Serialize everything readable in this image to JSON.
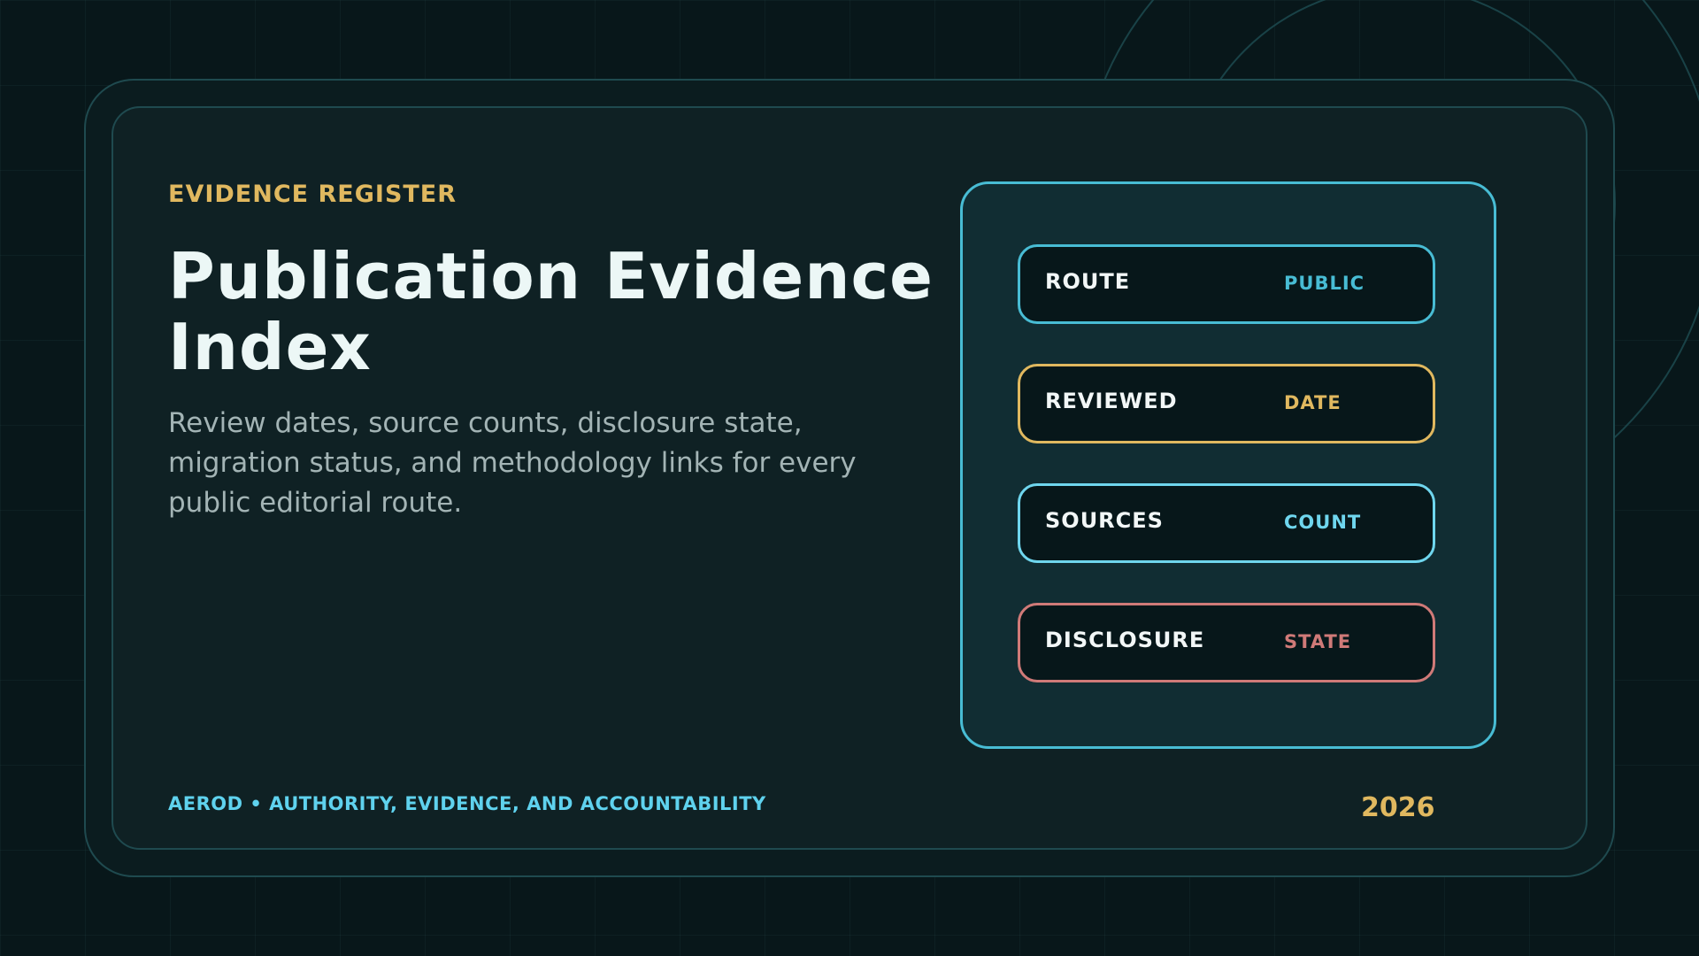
{
  "header": {
    "eyebrow": "EVIDENCE REGISTER",
    "title": "Publication Evidence Index",
    "description": "Review dates, source counts, disclosure state, migration status, and methodology links for every public editorial route."
  },
  "panel": {
    "items": [
      {
        "label": "ROUTE",
        "value": "PUBLIC",
        "color": "#48bcd4"
      },
      {
        "label": "REVIEWED",
        "value": "DATE",
        "color": "#e0b85f"
      },
      {
        "label": "SOURCES",
        "value": "COUNT",
        "color": "#6fd6ee"
      },
      {
        "label": "DISCLOSURE",
        "value": "STATE",
        "color": "#d07a78"
      }
    ]
  },
  "footer": {
    "tagline": "AEROD • AUTHORITY, EVIDENCE, AND ACCOUNTABILITY",
    "year": "2026"
  },
  "colors": {
    "background": "#08171a",
    "card": "#0f2124",
    "panel": "#112d33",
    "accent_gold": "#e0b85f",
    "accent_cyan": "#48bcd4",
    "title_text": "#ecf7f6",
    "body_text": "#a3b4b5"
  }
}
